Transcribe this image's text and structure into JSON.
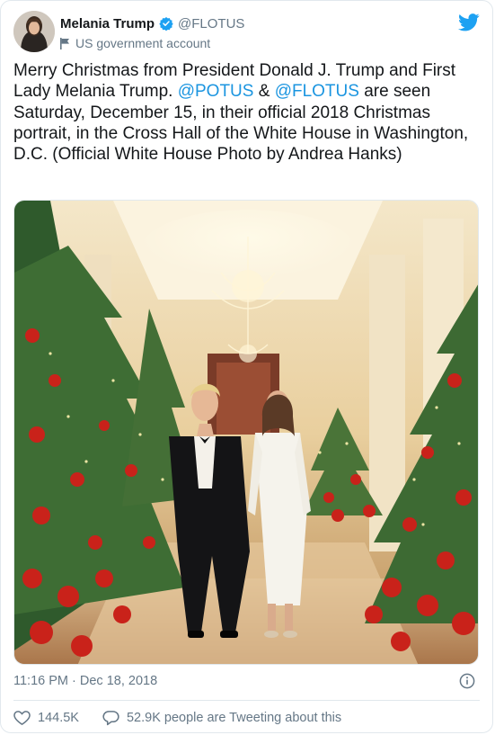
{
  "author": {
    "display_name": "Melania Trump",
    "handle": "@FLOTUS",
    "account_label": "US government account"
  },
  "tweet": {
    "text_parts": [
      "Merry Christmas from President Donald J. Trump and First Lady Melania Trump. ",
      "@POTUS",
      " & ",
      "@FLOTUS",
      " are seen Saturday, December 15, in their official 2018 Christmas portrait, in the Cross Hall of the White House in Washington, D.C. (Official White House Photo by Andrea Hanks)"
    ],
    "timestamp": "11:16 PM · Dec 18, 2018"
  },
  "engagement": {
    "likes": "144.5K",
    "tweeting": "52.9K people are Tweeting about this"
  },
  "colors": {
    "link": "#1b95e0",
    "muted": "#657786",
    "text": "#14171a",
    "brand": "#1da1f2"
  },
  "icons": [
    "verified-badge-icon",
    "flag-icon",
    "twitter-bird-icon",
    "info-icon",
    "heart-icon",
    "speech-bubble-icon"
  ]
}
